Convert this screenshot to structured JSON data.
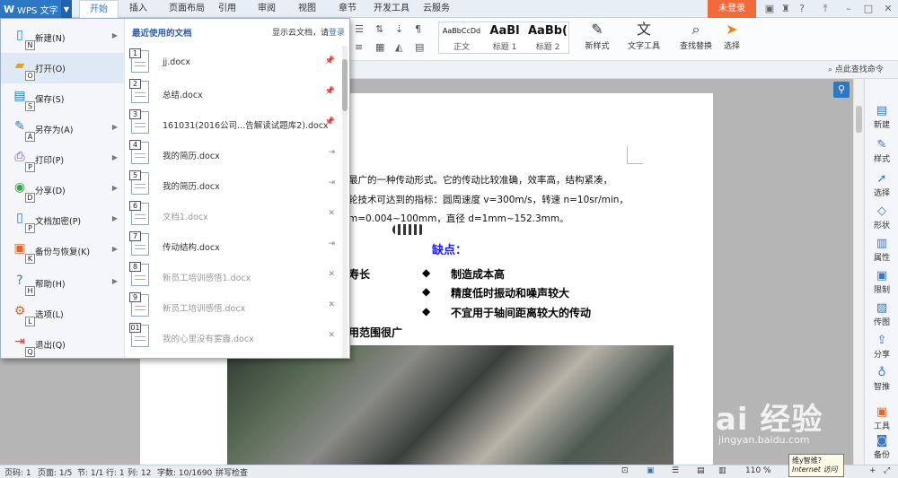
{
  "app": {
    "name": "WPS 文字",
    "logo": "W"
  },
  "tabs": [
    {
      "label": "开始",
      "active": true
    },
    {
      "label": "插入"
    },
    {
      "label": "页面布局"
    },
    {
      "label": "引用"
    },
    {
      "label": "审阅"
    },
    {
      "label": "视图"
    },
    {
      "label": "章节"
    },
    {
      "label": "开发工具"
    },
    {
      "label": "云服务"
    }
  ],
  "login_label": "未登录",
  "ribbon": {
    "styles": [
      {
        "preview": "AaBbCcDd",
        "name": "正文"
      },
      {
        "preview": "AaBl",
        "name": "标题 1"
      },
      {
        "preview": "AaBb(",
        "name": "标题 2"
      }
    ],
    "new_style": "新样式",
    "text_tools": "文字工具",
    "find_replace": "查找替换",
    "select": "选择"
  },
  "find_command": "点此查找命令",
  "menu": {
    "items": [
      {
        "label": "新建(N)",
        "key": "N",
        "icon": "new-doc-icon",
        "has_sub": true
      },
      {
        "label": "打开(O)",
        "key": "O",
        "icon": "folder-open-icon",
        "selected": true
      },
      {
        "label": "保存(S)",
        "key": "S",
        "icon": "save-icon"
      },
      {
        "label": "另存为(A)",
        "key": "A",
        "icon": "save-as-icon",
        "has_sub": true
      },
      {
        "label": "打印(P)",
        "key": "P",
        "icon": "printer-icon",
        "has_sub": true
      },
      {
        "label": "分享(D)",
        "key": "D",
        "icon": "share-icon",
        "has_sub": true
      },
      {
        "label": "文档加密(P)",
        "key": "P",
        "icon": "encrypt-icon",
        "has_sub": true
      },
      {
        "label": "备份与恢复(K)",
        "key": "K",
        "icon": "backup-icon",
        "has_sub": true
      },
      {
        "label": "帮助(H)",
        "key": "H",
        "icon": "help-icon",
        "has_sub": true
      },
      {
        "label": "选项(L)",
        "key": "L",
        "icon": "options-gear-icon"
      },
      {
        "label": "退出(Q)",
        "key": "Q",
        "icon": "exit-icon"
      }
    ],
    "recent_title": "最近使用的文档",
    "cloud_text": "显示云文档，请",
    "cloud_login": "登录",
    "recent": [
      {
        "num": "1",
        "name": "jj.docx",
        "pinned": true
      },
      {
        "num": "2",
        "name": "总结.docx",
        "pinned": true
      },
      {
        "num": "3",
        "name": "161031(2016公司...告解读试题库2).docx",
        "pinned": true
      },
      {
        "num": "4",
        "name": "我的简历.docx",
        "pinned": false
      },
      {
        "num": "5",
        "name": "我的简历.docx",
        "pinned": false
      },
      {
        "num": "6",
        "name": "文档1.docx",
        "dim": true
      },
      {
        "num": "7",
        "name": "传动结构.docx",
        "pinned": false
      },
      {
        "num": "8",
        "name": "新员工培训感悟1.docx",
        "dim": true
      },
      {
        "num": "9",
        "name": "新员工培训感悟.docx",
        "dim": true
      },
      {
        "num": "01",
        "name": "我的心里没有雾霾.docx",
        "dim": true
      }
    ]
  },
  "document": {
    "lines": [
      "最广的一种传动形式。它的传动比较准确，效率高，结构紧凑，",
      "轮技术可达到的指标：圆周速度 v=300m/s，转速 n=10sr/min，",
      "m=0.004~100mm，直径 d=1mm~152.3mm。"
    ],
    "cons_title": "缺点：",
    "left_frag1": "寿长",
    "left_frag2": "用范围很广",
    "cons": [
      "制造成本高",
      "精度低时振动和噪声较大",
      "不宜用于轴间距离较大的传动"
    ]
  },
  "right_sidebar": [
    "新建",
    "样式",
    "选择",
    "形状",
    "属性",
    "限制",
    "传图",
    "分享",
    "智推",
    "工具",
    "备份"
  ],
  "status": {
    "page_code": "页码: 1",
    "page": "页面: 1/5",
    "section": "节: 1/1",
    "line": "行: 1",
    "col": "列: 12",
    "chars": "字数: 10/1690",
    "spell": "拼写检查",
    "zoom": "110 %"
  },
  "tooltip": {
    "line1": "维y智维?",
    "line2": "Internet 访问"
  },
  "watermark": {
    "text": "Bai 经验",
    "url": "jingyan.baidu.com"
  }
}
